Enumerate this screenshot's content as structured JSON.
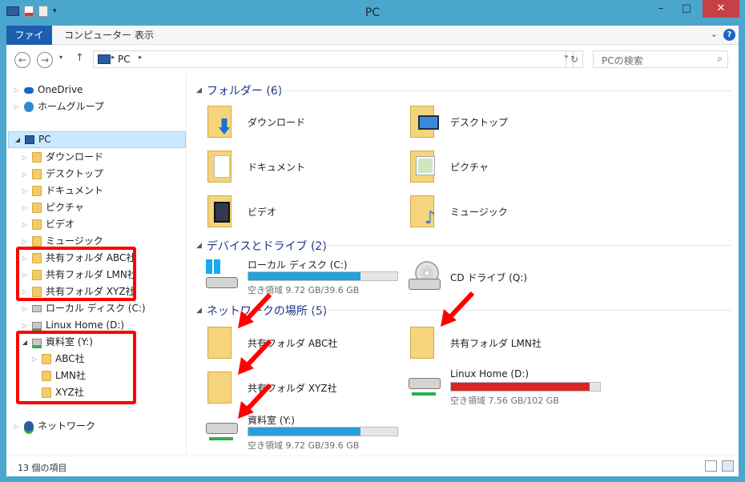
{
  "window": {
    "title": "PC"
  },
  "ribbon": {
    "tabs": [
      "ファイル",
      "コンピューター",
      "表示"
    ],
    "help": "?"
  },
  "nav": {
    "path": "PC",
    "search_placeholder": "PCの検索"
  },
  "tree": {
    "onedrive": "OneDrive",
    "homegroup": "ホームグループ",
    "pc": "PC",
    "children": [
      "ダウンロード",
      "デスクトップ",
      "ドキュメント",
      "ピクチャ",
      "ビデオ",
      "ミュージック",
      "共有フォルダ ABC社",
      "共有フォルダ LMN社",
      "共有フォルダ XYZ社",
      "ローカル ディスク (C:)",
      "Linux Home (D:)",
      "資料室 (Y:)"
    ],
    "y_children": [
      "ABC社",
      "LMN社",
      "XYZ社"
    ],
    "network": "ネットワーク"
  },
  "groups": {
    "folders": "フォルダー (6)",
    "devices": "デバイスとドライブ (2)",
    "network": "ネットワークの場所 (5)"
  },
  "folders": [
    "ダウンロード",
    "デスクトップ",
    "ドキュメント",
    "ピクチャ",
    "ビデオ",
    "ミュージック"
  ],
  "drives": [
    {
      "name": "ローカル ディスク (C:)",
      "free": "空き領域 9.72 GB/39.6 GB",
      "used_fraction": 0.75,
      "color": "#26a0da"
    },
    {
      "name": "CD ドライブ (Q:)"
    }
  ],
  "network_items": [
    {
      "name": "共有フォルダ ABC社"
    },
    {
      "name": "共有フォルダ LMN社"
    },
    {
      "name": "共有フォルダ XYZ社"
    },
    {
      "name": "Linux Home (D:)",
      "free": "空き領域 7.56 GB/102 GB",
      "used_fraction": 0.93,
      "color": "#da2626"
    },
    {
      "name": "資料室 (Y:)",
      "free": "空き領域 9.72 GB/39.6 GB",
      "used_fraction": 0.75,
      "color": "#26a0da"
    }
  ],
  "status": {
    "count": "13 個の項目"
  },
  "colors": {
    "accent": "#1c5fae",
    "annotation": "#ff0000",
    "window_frame": "#4aa6cc"
  }
}
